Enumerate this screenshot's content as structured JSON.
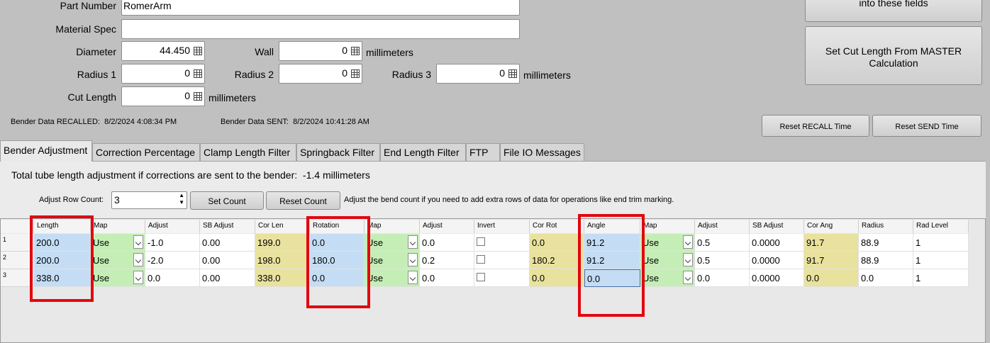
{
  "fields": {
    "part_number_label": "Part Number",
    "part_number_value": "RomerArm",
    "material_spec_label": "Material Spec",
    "material_spec_value": "",
    "diameter_label": "Diameter",
    "diameter_value": "44.450",
    "wall_label": "Wall",
    "wall_value": "0",
    "wall_unit": "millimeters",
    "radius1_label": "Radius 1",
    "radius1_value": "0",
    "radius2_label": "Radius 2",
    "radius2_value": "0",
    "radius3_label": "Radius 3",
    "radius3_value": "0",
    "radius_unit": "millimeters",
    "cut_length_label": "Cut Length",
    "cut_length_value": "0",
    "cut_length_unit": "millimeters"
  },
  "buttons": {
    "top_partial": "into these fields",
    "set_cut_length": "Set Cut Length From MASTER Calculation",
    "reset_recall": "Reset RECALL Time",
    "reset_send": "Reset SEND Time",
    "set_count": "Set Count",
    "reset_count": "Reset Count"
  },
  "status": {
    "recalled_label": "Bender Data RECALLED:",
    "recalled_value": "8/2/2024 4:08:34 PM",
    "sent_label": "Bender Data SENT:",
    "sent_value": "8/2/2024 10:41:28 AM"
  },
  "tabs": [
    "Bender Adjustment",
    "Correction Percentage",
    "Clamp Length Filter",
    "Springback Filter",
    "End Length Filter",
    "FTP",
    "File IO Messages"
  ],
  "panel": {
    "total_label": "Total tube length adjustment if corrections are sent to the bender:",
    "total_value": "-1.4",
    "total_unit": "millimeters",
    "row_count_label": "Adjust Row Count:",
    "row_count_value": "3",
    "help_text": "Adjust the bend count if you need to add extra rows of data for operations like end trim marking."
  },
  "grid": {
    "headers": [
      "Length",
      "Map",
      "Adjust",
      "SB Adjust",
      "Cor Len",
      "Rotation",
      "Map",
      "Adjust",
      "Invert",
      "Cor Rot",
      "Angle",
      "Map",
      "Adjust",
      "SB Adjust",
      "Cor Ang",
      "Radius",
      "Rad Level"
    ],
    "rows": [
      {
        "num": "1",
        "cells": [
          "200.0",
          "Use",
          "-1.0",
          "0.00",
          "199.0",
          "0.0",
          "Use",
          "0.0",
          "",
          "0.0",
          "91.2",
          "Use",
          "0.5",
          "0.0000",
          "91.7",
          "88.9",
          "1"
        ]
      },
      {
        "num": "2",
        "cells": [
          "200.0",
          "Use",
          "-2.0",
          "0.00",
          "198.0",
          "180.0",
          "Use",
          "0.2",
          "",
          "180.2",
          "91.2",
          "Use",
          "0.5",
          "0.0000",
          "91.7",
          "88.9",
          "1"
        ]
      },
      {
        "num": "3",
        "cells": [
          "338.0",
          "Use",
          "0.0",
          "0.00",
          "338.0",
          "0.0",
          "Use",
          "0.0",
          "",
          "0.0",
          "0.0",
          "Use",
          "0.0",
          "0.0000",
          "0.0",
          "0.0",
          "1"
        ]
      }
    ]
  },
  "colors": {
    "highlight_red": "#e3060f",
    "blue_cell": "#c4ddf4",
    "green_cell": "#c5eeb6",
    "yellow_cell": "#e9e29e"
  }
}
